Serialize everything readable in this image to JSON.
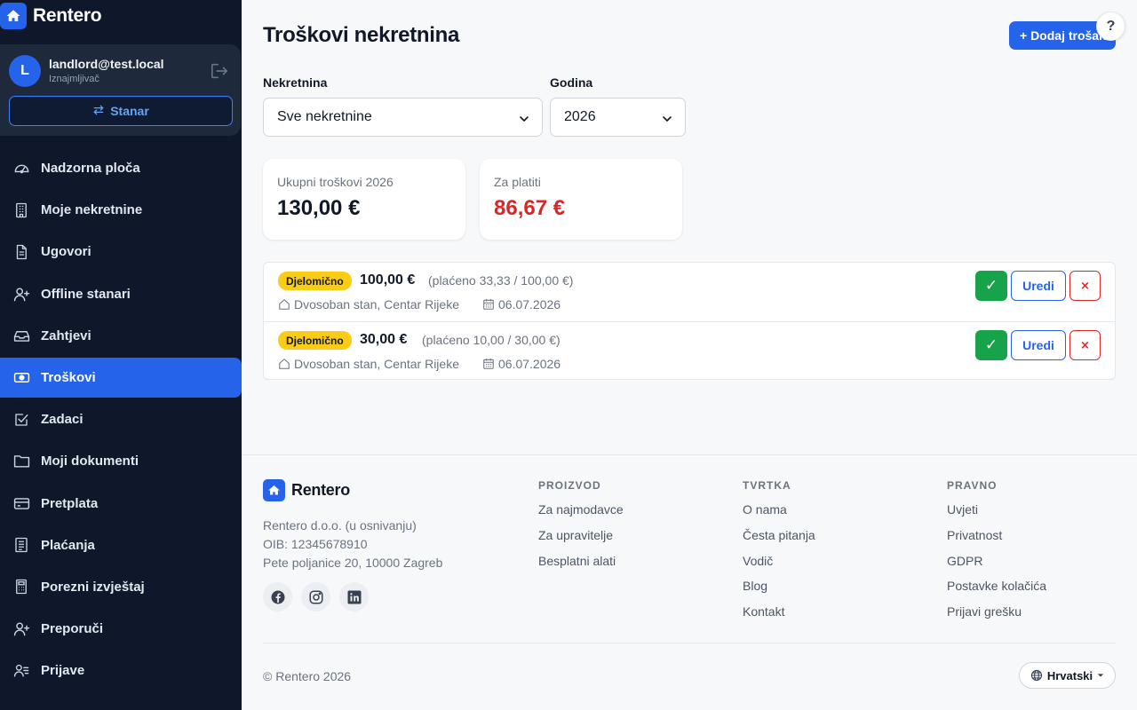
{
  "app": {
    "name": "Rentero"
  },
  "user": {
    "initial": "L",
    "email": "landlord@test.local",
    "role": "Iznajmljivač",
    "switch_label": "Stanar"
  },
  "nav": [
    {
      "label": "Nadzorna ploča",
      "icon": "dashboard-icon"
    },
    {
      "label": "Moje nekretnine",
      "icon": "building-icon"
    },
    {
      "label": "Ugovori",
      "icon": "document-icon"
    },
    {
      "label": "Offline stanari",
      "icon": "user-plus-icon"
    },
    {
      "label": "Zahtjevi",
      "icon": "inbox-icon"
    },
    {
      "label": "Troškovi",
      "icon": "money-icon",
      "active": true
    },
    {
      "label": "Zadaci",
      "icon": "checkbox-icon"
    },
    {
      "label": "Moji dokumenti",
      "icon": "folder-icon"
    },
    {
      "label": "Pretplata",
      "icon": "credit-card-icon"
    },
    {
      "label": "Plaćanja",
      "icon": "receipt-icon"
    },
    {
      "label": "Porezni izvještaj",
      "icon": "calculator-icon"
    },
    {
      "label": "Preporuči",
      "icon": "user-plus-icon"
    },
    {
      "label": "Prijave",
      "icon": "id-card-icon"
    }
  ],
  "page": {
    "title": "Troškovi nekretnina",
    "add_button": "+ Dodaj trošak",
    "help": "?"
  },
  "filters": {
    "property_label": "Nekretnina",
    "property_value": "Sve nekretnine",
    "year_label": "Godina",
    "year_value": "2026"
  },
  "stats": {
    "total_label": "Ukupni troškovi 2026",
    "total_value": "130,00 €",
    "due_label": "Za platiti",
    "due_value": "86,67 €",
    "due_color": "#dc2626"
  },
  "expenses": [
    {
      "status": "Djelomično",
      "amount": "100,00 €",
      "paid": "(plaćeno 33,33 / 100,00 €)",
      "property": "Dvosoban stan, Centar Rijeke",
      "date": "06.07.2026",
      "confirm": "✓",
      "edit": "Uredi",
      "delete": "×"
    },
    {
      "status": "Djelomično",
      "amount": "30,00 €",
      "paid": "(plaćeno 10,00 / 30,00 €)",
      "property": "Dvosoban stan, Centar Rijeke",
      "date": "06.07.2026",
      "confirm": "✓",
      "edit": "Uredi",
      "delete": "×"
    }
  ],
  "footer": {
    "brand": "Rentero",
    "company": "Rentero d.o.o. (u osnivanju)",
    "oib": "OIB: 12345678910",
    "address": "Pete poljanice 20, 10000 Zagreb",
    "columns": [
      {
        "title": "PROIZVOD",
        "links": [
          "Za najmodavce",
          "Za upravitelje",
          "Besplatni alati"
        ]
      },
      {
        "title": "TVRTKA",
        "links": [
          "O nama",
          "Česta pitanja",
          "Vodič",
          "Blog",
          "Kontakt"
        ]
      },
      {
        "title": "PRAVNO",
        "links": [
          "Uvjeti",
          "Privatnost",
          "GDPR",
          "Postavke kolačića",
          "Prijavi grešku"
        ]
      }
    ],
    "copyright": "© Rentero 2026",
    "language": "Hrvatski"
  },
  "colors": {
    "primary": "#2563eb",
    "sidebar_bg": "#0f172a",
    "badge": "#facc15",
    "success": "#16a34a",
    "danger": "#dc2626"
  }
}
